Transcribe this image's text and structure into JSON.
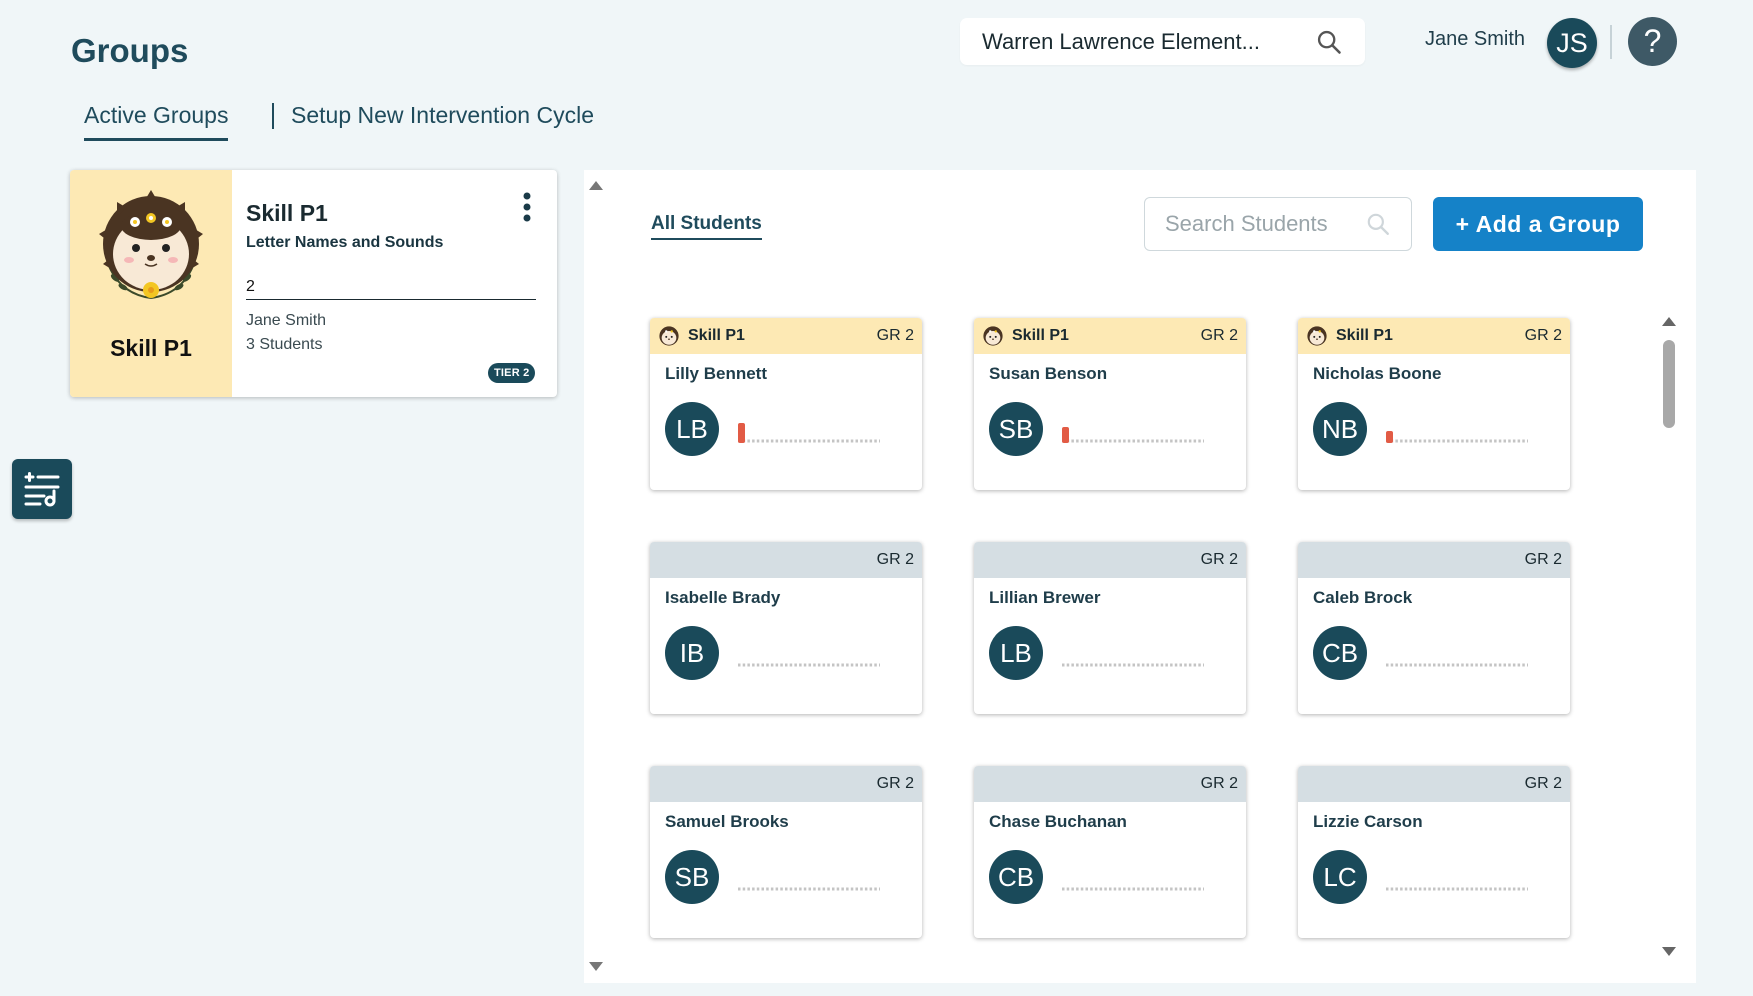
{
  "header": {
    "page_title": "Groups",
    "school": "Warren Lawrence Element...",
    "user_name": "Jane Smith",
    "user_initials": "JS",
    "help_glyph": "?"
  },
  "tabs": {
    "active": "Active Groups",
    "setup": "Setup New Intervention Cycle"
  },
  "group_card": {
    "image_label": "Skill P1",
    "title": "Skill P1",
    "subtitle": "Letter Names and Sounds",
    "number": "2",
    "teacher": "Jane Smith",
    "student_count": "3 Students",
    "tier": "TIER 2"
  },
  "panel": {
    "all_students": "All Students",
    "search_placeholder": "Search Students",
    "add_group": "+ Add a Group"
  },
  "students": [
    {
      "name": "Lilly Bennett",
      "initials": "LB",
      "grade": "GR 2",
      "skill": "Skill P1",
      "progress_bars": 1,
      "bar_heights": [
        0.75
      ]
    },
    {
      "name": "Susan Benson",
      "initials": "SB",
      "grade": "GR 2",
      "skill": "Skill P1",
      "progress_bars": 1,
      "bar_heights": [
        0.6
      ]
    },
    {
      "name": "Nicholas Boone",
      "initials": "NB",
      "grade": "GR 2",
      "skill": "Skill P1",
      "progress_bars": 1,
      "bar_heights": [
        0.45
      ]
    },
    {
      "name": "Isabelle Brady",
      "initials": "IB",
      "grade": "GR 2",
      "skill": "",
      "progress_bars": 0,
      "bar_heights": []
    },
    {
      "name": "Lillian Brewer",
      "initials": "LB",
      "grade": "GR 2",
      "skill": "",
      "progress_bars": 0,
      "bar_heights": []
    },
    {
      "name": "Caleb Brock",
      "initials": "CB",
      "grade": "GR 2",
      "skill": "",
      "progress_bars": 0,
      "bar_heights": []
    },
    {
      "name": "Samuel Brooks",
      "initials": "SB",
      "grade": "GR 2",
      "skill": "",
      "progress_bars": 0,
      "bar_heights": []
    },
    {
      "name": "Chase Buchanan",
      "initials": "CB",
      "grade": "GR 2",
      "skill": "",
      "progress_bars": 0,
      "bar_heights": []
    },
    {
      "name": "Lizzie Carson",
      "initials": "LC",
      "grade": "GR 2",
      "skill": "",
      "progress_bars": 0,
      "bar_heights": []
    }
  ],
  "colors": {
    "primary": "#1a4a5a",
    "accent": "#1582c8",
    "skill_header": "#fde9b4",
    "plain_header": "#d5dee3",
    "progress_bar": "#e25b45"
  },
  "icons": {
    "search": "search-icon",
    "menu": "kebab-menu-icon",
    "filter": "filter-sliders-icon",
    "mascot": "hedgehog-icon"
  }
}
